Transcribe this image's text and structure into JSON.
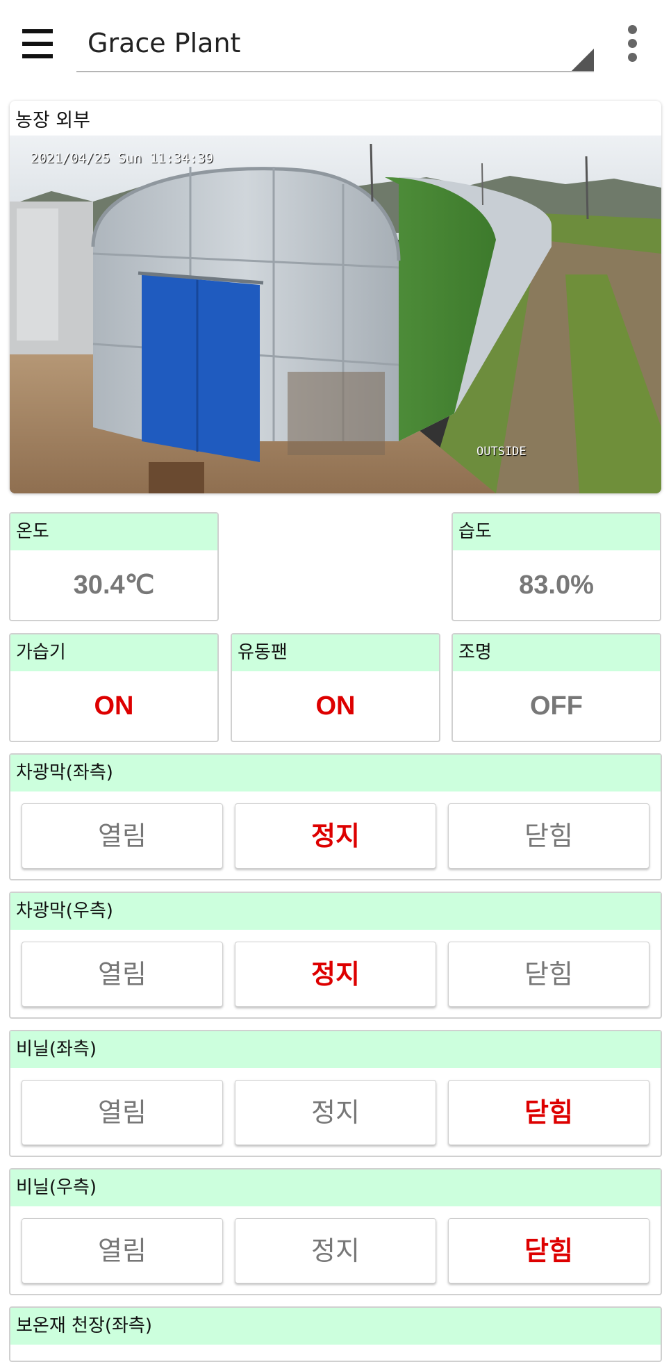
{
  "app_bar": {
    "plant_name": "Grace Plant",
    "menu_icon": "hamburger-menu-icon",
    "more_icon": "more-vert-icon"
  },
  "camera": {
    "title": "농장 외부",
    "timestamp": "2021/04/25 Sun 11:34:39",
    "camera_label": "OUTSIDE"
  },
  "sensors": {
    "temperature": {
      "label": "온도",
      "value": "30.4℃"
    },
    "humidity": {
      "label": "습도",
      "value": "83.0%"
    }
  },
  "devices": {
    "humidifier": {
      "label": "가습기",
      "value": "ON"
    },
    "circulation_fan": {
      "label": "유동팬",
      "value": "ON"
    },
    "lighting": {
      "label": "조명",
      "value": "OFF"
    }
  },
  "controls": [
    {
      "title": "차광막(좌측)",
      "open": "열림",
      "stop": "정지",
      "close": "닫힘",
      "active": "stop"
    },
    {
      "title": "차광막(우측)",
      "open": "열림",
      "stop": "정지",
      "close": "닫힘",
      "active": "stop"
    },
    {
      "title": "비닐(좌측)",
      "open": "열림",
      "stop": "정지",
      "close": "닫힘",
      "active": "close"
    },
    {
      "title": "비닐(우측)",
      "open": "열림",
      "stop": "정지",
      "close": "닫힘",
      "active": "close"
    }
  ],
  "partial_control": {
    "title": "보온재 천장(좌측)"
  },
  "colors": {
    "header_bg": "#ccffdd",
    "active_red": "#dd0000",
    "inactive_gray": "#777777"
  }
}
